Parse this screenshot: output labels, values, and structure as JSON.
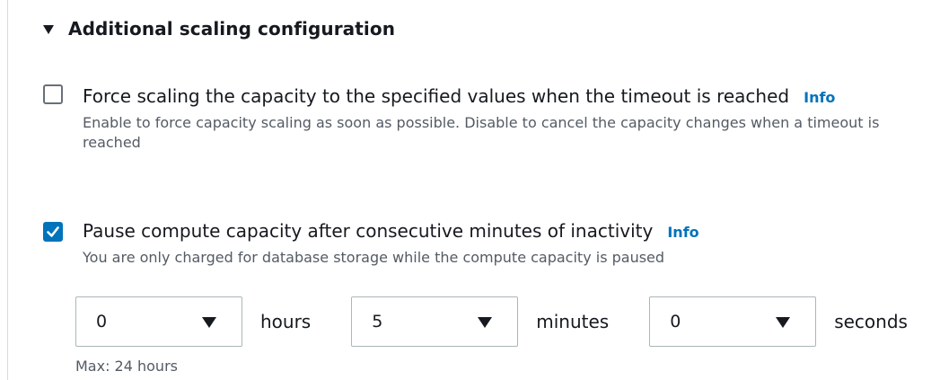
{
  "section": {
    "title": "Additional scaling configuration",
    "expanded": true,
    "icon": "caret-down-icon"
  },
  "force_scaling": {
    "checked": false,
    "label": "Force scaling the capacity to the specified values when the timeout is reached",
    "info": "Info",
    "description": "Enable to force capacity scaling as soon as possible. Disable to cancel the capacity changes when a timeout is reached"
  },
  "pause_compute": {
    "checked": true,
    "label": "Pause compute capacity after consecutive minutes of inactivity",
    "info": "Info",
    "description": "You are only charged for database storage while the compute capacity is paused"
  },
  "timeout": {
    "hours": {
      "value": "0",
      "unit": "hours"
    },
    "minutes": {
      "value": "5",
      "unit": "minutes"
    },
    "seconds": {
      "value": "0",
      "unit": "seconds"
    },
    "hint": "Max: 24 hours"
  },
  "colors": {
    "accent": "#0073bb",
    "text": "#16191f",
    "secondary_text": "#545b64",
    "border": "#aab7b8"
  }
}
